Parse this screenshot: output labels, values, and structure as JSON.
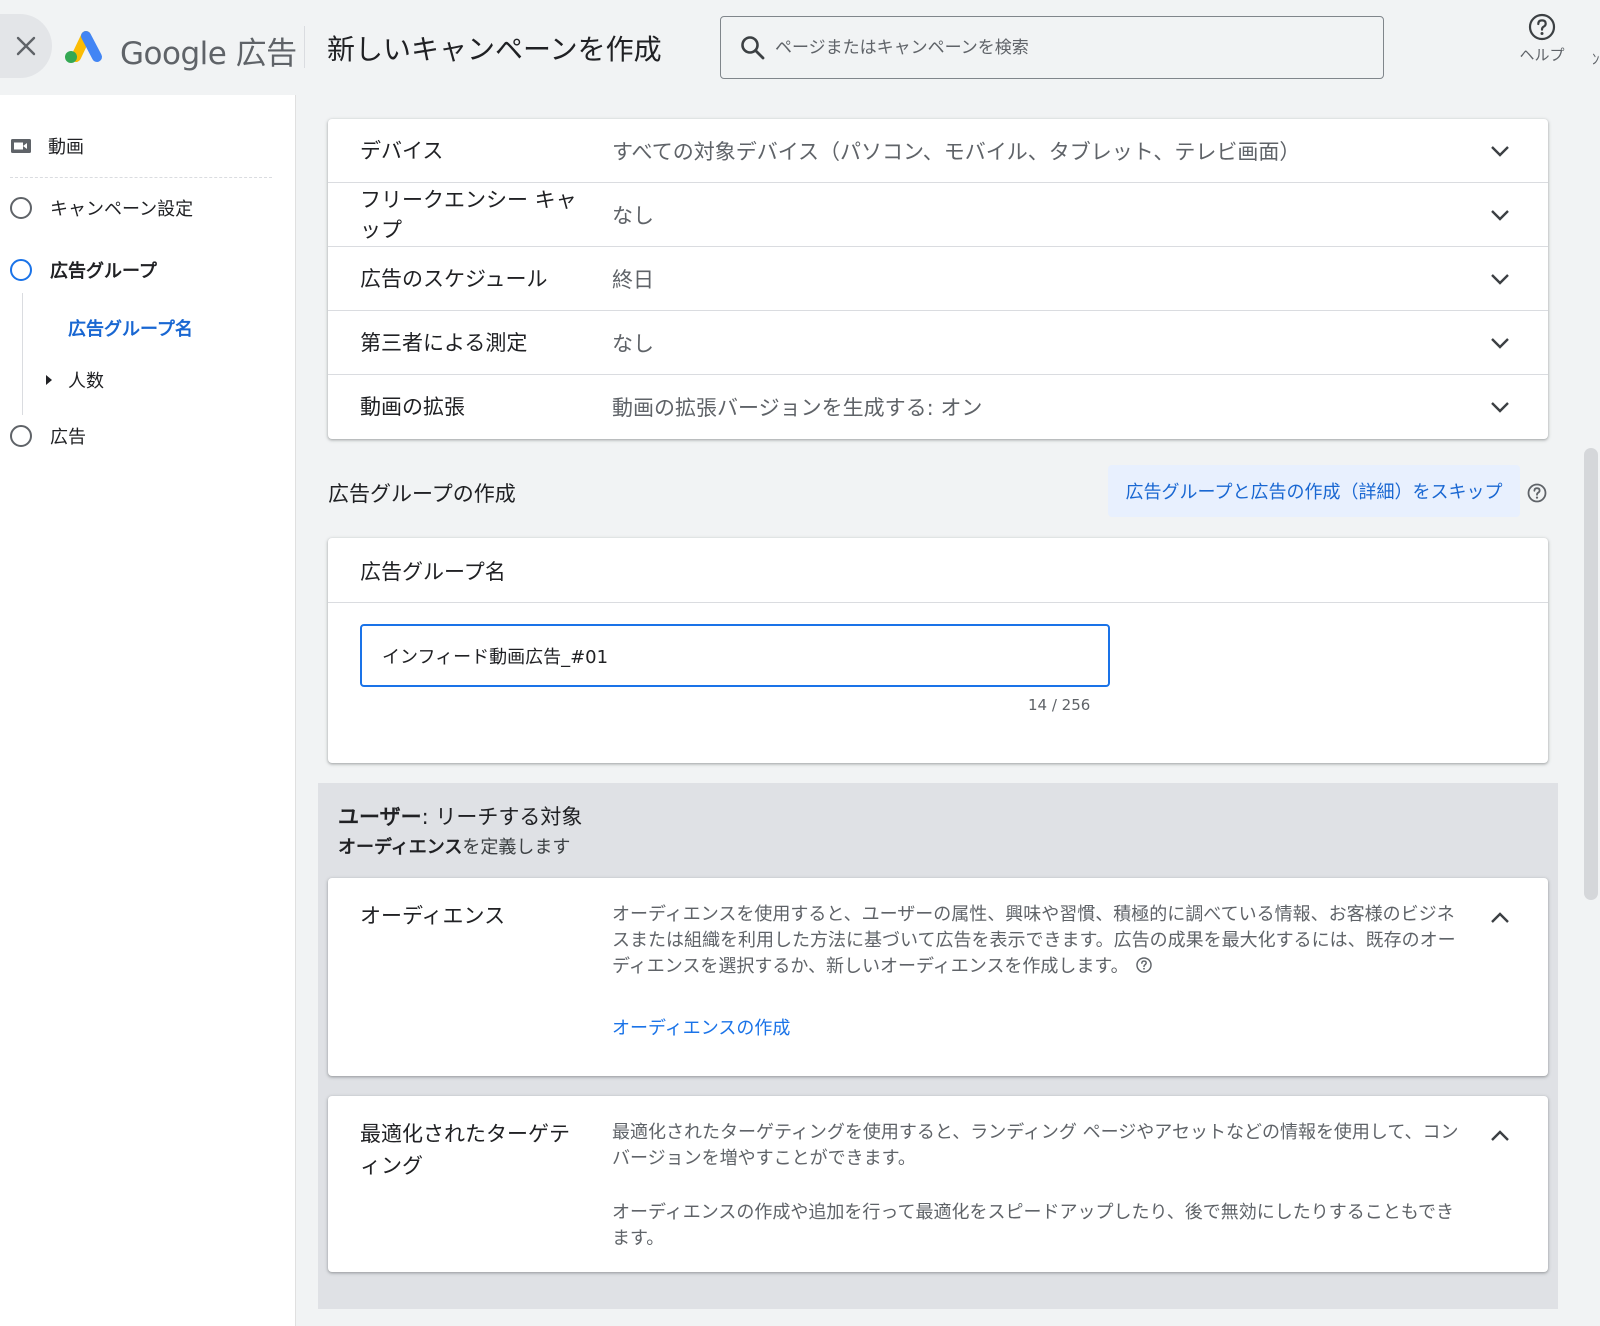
{
  "header": {
    "close_icon": "close-icon",
    "logo_text": "Google 広告",
    "page_title": "新しいキャンペーンを作成",
    "search_placeholder": "ページまたはキャンペーンを検索",
    "help_label": "ヘルプ",
    "cut_glyph": "ﾝ"
  },
  "sidebar": {
    "video": "動画",
    "campaign_settings": "キャンペーン設定",
    "ad_group": "広告グループ",
    "ad_group_name": "広告グループ名",
    "people": "人数",
    "ads": "広告"
  },
  "settings": {
    "rows": [
      {
        "label": "デバイス",
        "value": "すべての対象デバイス（パソコン、モバイル、タブレット、テレビ画面）"
      },
      {
        "label": "フリークエンシー キャップ",
        "value": "なし"
      },
      {
        "label": "広告のスケジュール",
        "value": "終日"
      },
      {
        "label": "第三者による測定",
        "value": "なし"
      },
      {
        "label": "動画の拡張",
        "value": "動画の拡張バージョンを生成する: オン"
      }
    ]
  },
  "adgroup": {
    "section_title": "広告グループの作成",
    "skip_button": "広告グループと広告の作成（詳細）をスキップ",
    "name_label": "広告グループ名",
    "name_value": "インフィード動画広告_#01",
    "char_count": "14 / 256"
  },
  "users": {
    "title_bold": "ユーザー",
    "title_rest": ": リーチする対象",
    "sub_bold": "オーディエンス",
    "sub_rest": "を定義します",
    "audience": {
      "label": "オーディエンス",
      "description": "オーディエンスを使用すると、ユーザーの属性、興味や習慣、積極的に調べている情報、お客様のビジネスまたは組織を利用した方法に基づいて広告を表示できます。広告の成果を最大化するには、既存のオーディエンスを選択するか、新しいオーディエンスを作成します。",
      "link": "オーディエンスの作成"
    },
    "targeting": {
      "label": "最適化されたターゲティング",
      "description1": "最適化されたターゲティングを使用すると、ランディング ページやアセットなどの情報を使用して、コンバージョンを増やすことができます。",
      "description2": "オーディエンスの作成や追加を行って最適化をスピードアップしたり、後で無効にしたりすることもできます。"
    }
  },
  "colors": {
    "accent": "#1a73e8",
    "background": "#f1f3f4",
    "panel": "#dfe1e5"
  }
}
